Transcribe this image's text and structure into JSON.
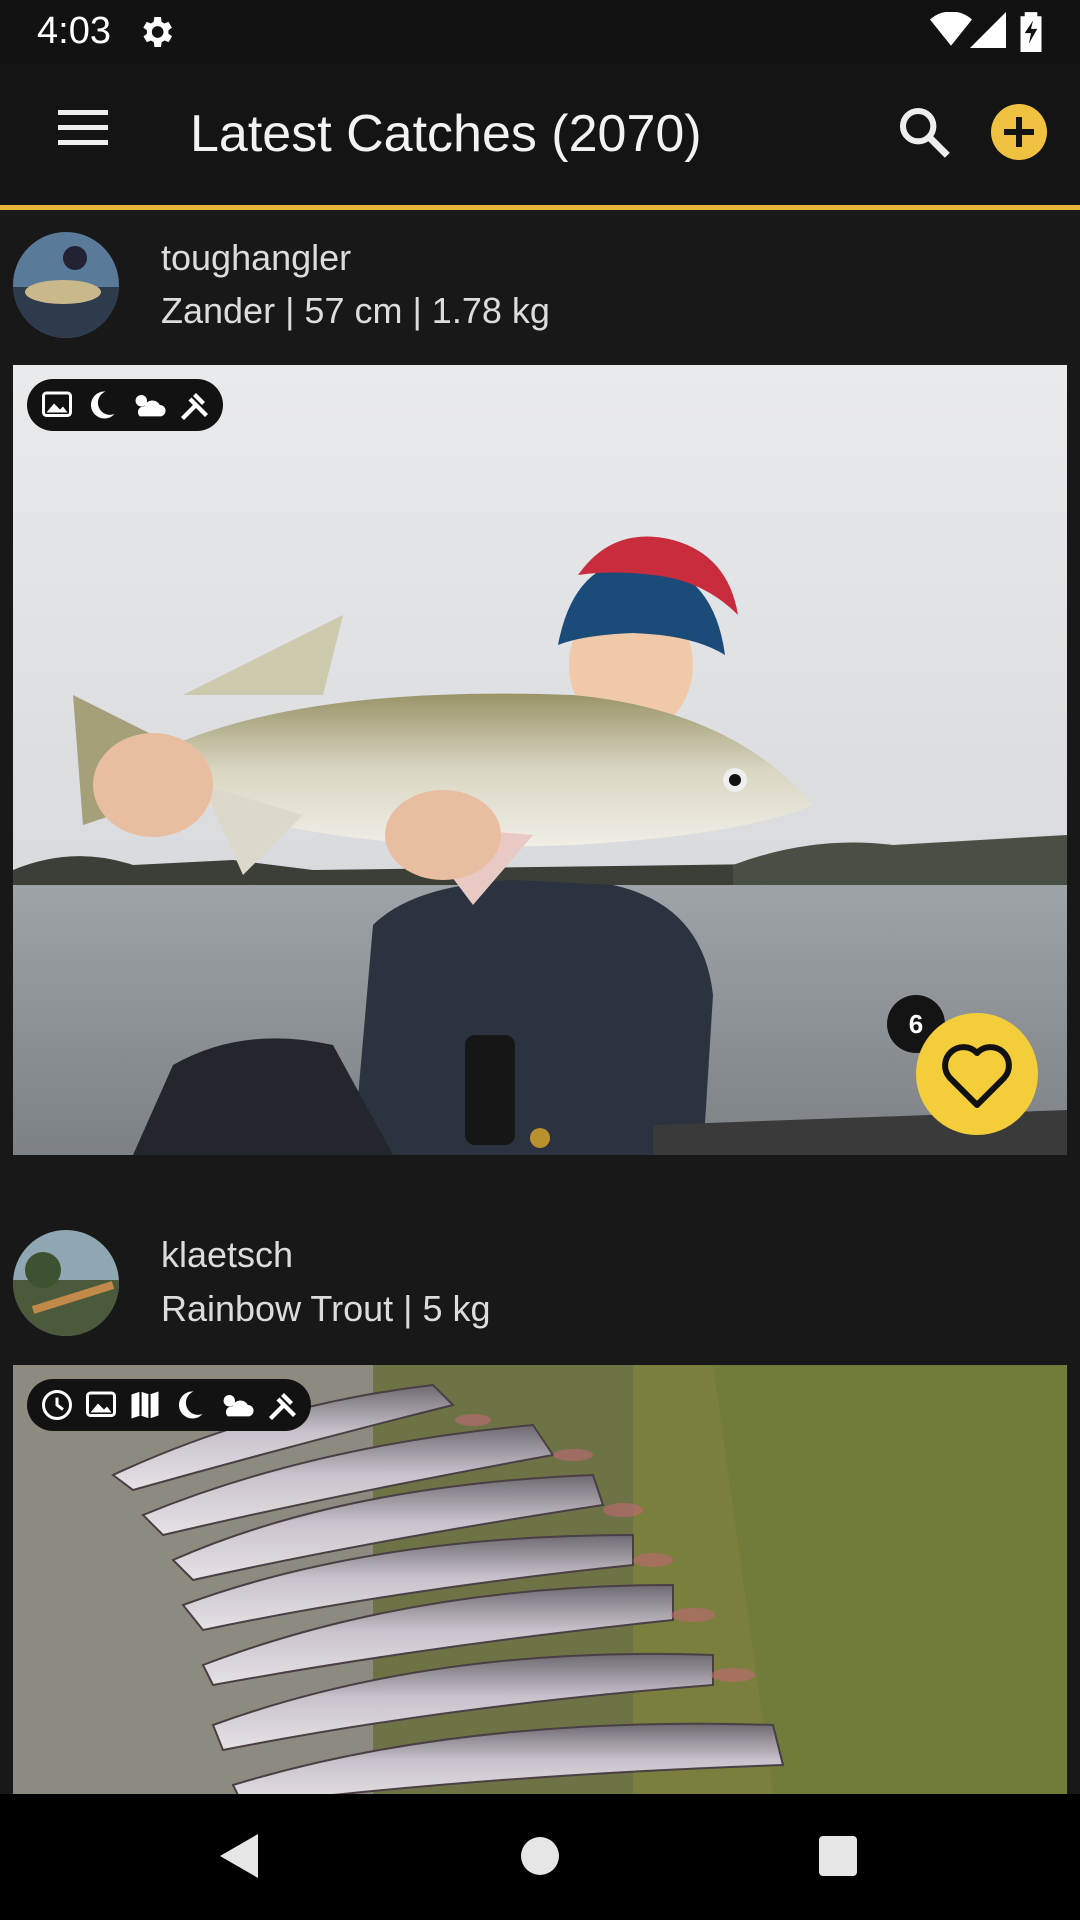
{
  "status_bar": {
    "time": "4:03"
  },
  "app_bar": {
    "title": "Latest Catches (2070)"
  },
  "posts": [
    {
      "username": "toughangler",
      "details": "Zander | 57 cm | 1.78 kg",
      "likes": "6"
    },
    {
      "username": "klaetsch",
      "details": "Rainbow Trout | 5 kg"
    }
  ],
  "colors": {
    "accent": "#e8b33a",
    "like_button": "#f4cd3b",
    "background": "#1a1a1a"
  },
  "icons": [
    "gear-icon",
    "wifi-icon",
    "signal-icon",
    "battery-icon",
    "menu-icon",
    "search-icon",
    "add-icon",
    "image-icon",
    "moon-icon",
    "weather-icon",
    "tools-icon",
    "clock-icon",
    "map-icon",
    "heart-icon",
    "back-icon",
    "home-icon",
    "recents-icon"
  ]
}
